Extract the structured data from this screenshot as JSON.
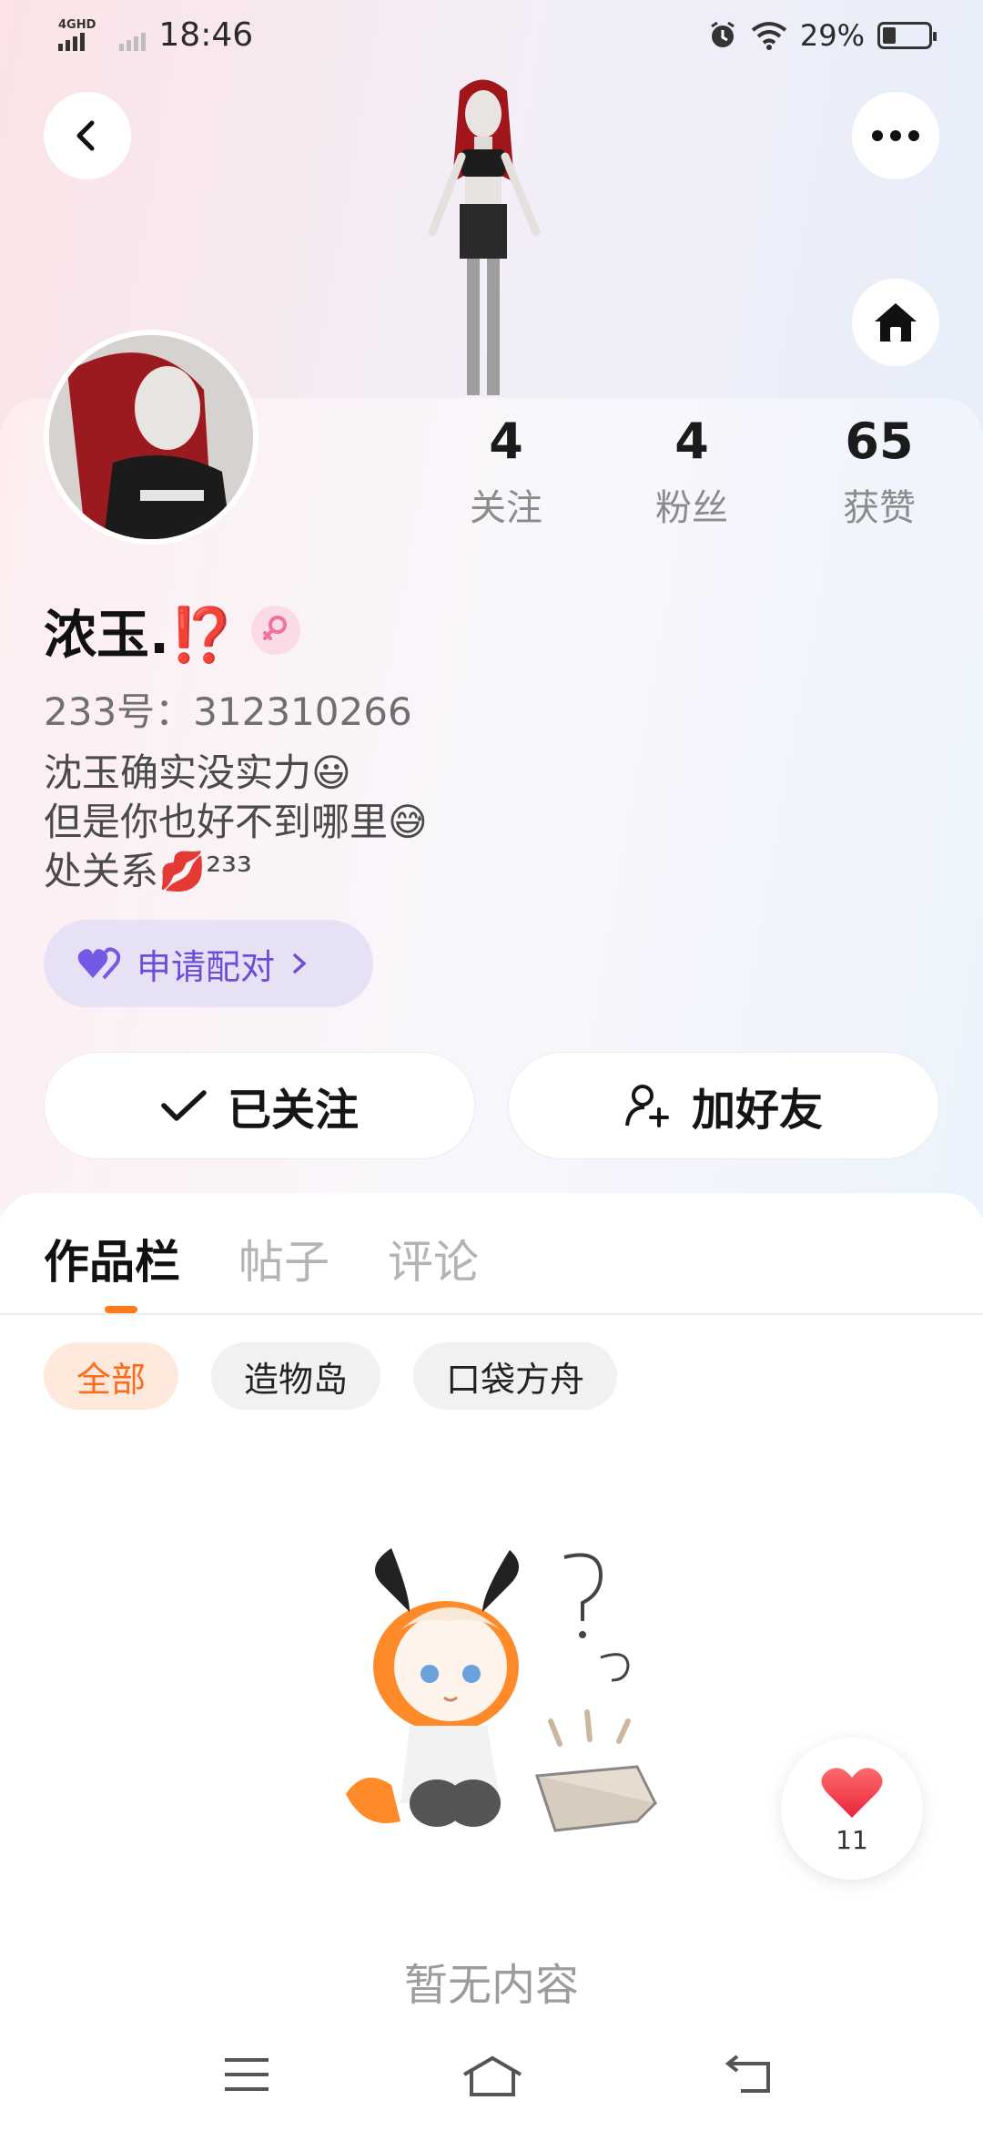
{
  "status_bar": {
    "network": "4GHD",
    "time": "18:46",
    "battery_percent": "29%",
    "battery_level": 0.29
  },
  "profile": {
    "name": "浓玉.⁉️",
    "uid_label": "233号：",
    "uid_value": "312310266",
    "bio_lines": [
      "沈玉确实没实力😃",
      "但是你也好不到哪里😅",
      "处关系💋²³³"
    ]
  },
  "stats": [
    {
      "value": "4",
      "label": "关注"
    },
    {
      "value": "4",
      "label": "粉丝"
    },
    {
      "value": "65",
      "label": "获赞"
    }
  ],
  "buttons": {
    "pair": "申请配对",
    "followed": "已关注",
    "add_friend": "加好友"
  },
  "tabs": [
    {
      "label": "作品栏",
      "active": true
    },
    {
      "label": "帖子",
      "active": false
    },
    {
      "label": "评论",
      "active": false
    }
  ],
  "chips": [
    {
      "label": "全部",
      "active": true
    },
    {
      "label": "造物岛",
      "active": false
    },
    {
      "label": "口袋方舟",
      "active": false
    }
  ],
  "empty_state": "暂无内容",
  "like_float": {
    "count": "11"
  },
  "colors": {
    "accent_orange": "#ff7a1a",
    "pair_purple": "#6a4fd8",
    "heart_red": "#f04a55"
  },
  "icons": [
    "back-icon",
    "more-icon",
    "home-icon",
    "heart-pair-icon",
    "check-icon",
    "add-friend-icon",
    "gender-female-icon",
    "heart-icon",
    "menu-icon",
    "home-nav-icon",
    "back-nav-icon"
  ]
}
